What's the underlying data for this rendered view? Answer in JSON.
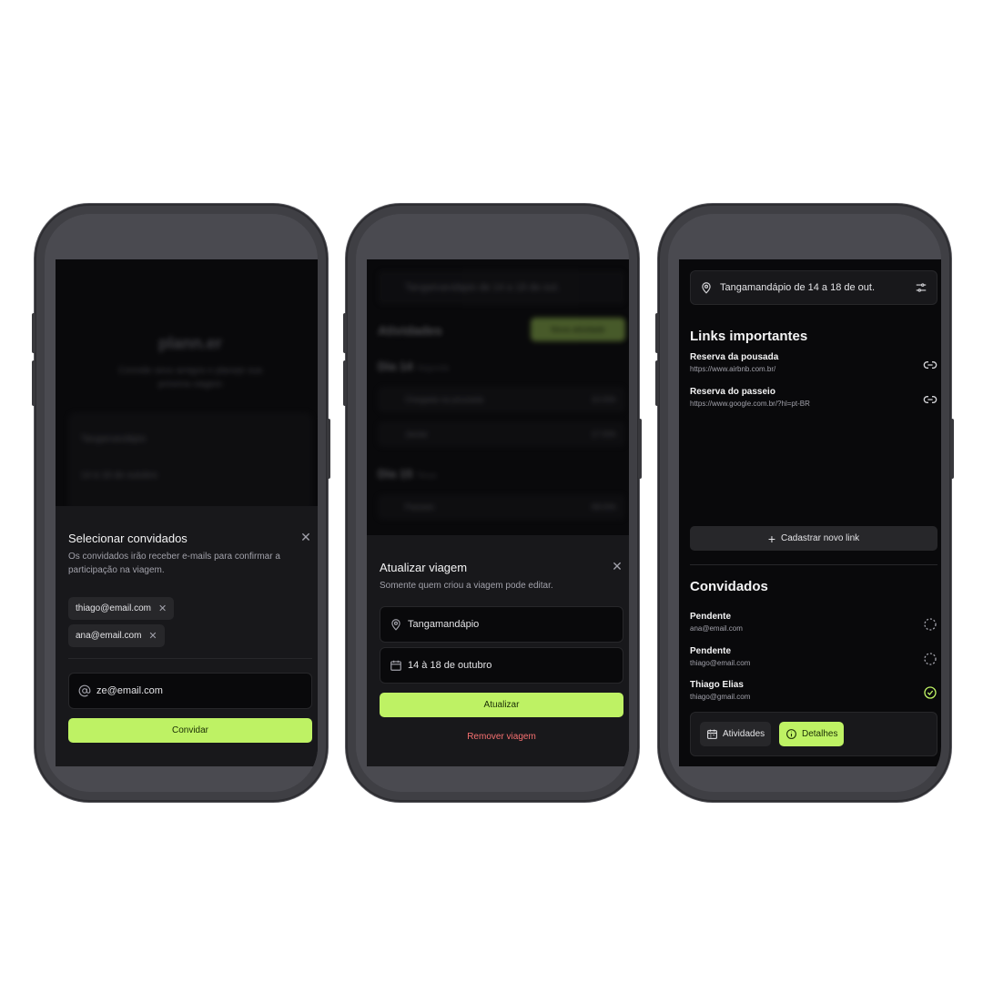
{
  "screen1": {
    "bg": {
      "logo": "plann.er",
      "subtitle": "Convide seus amigos e planeje sua próxima viagem",
      "destination": "Tangamandápio",
      "dates": "14 à 18 de outubro"
    },
    "sheet": {
      "title": "Selecionar convidados",
      "subtitle": "Os convidados irão receber e-mails para confirmar a participação na viagem.",
      "chips": [
        "thiago@email.com",
        "ana@email.com"
      ],
      "input_value": "ze@email.com",
      "button": "Convidar"
    }
  },
  "screen2": {
    "bg": {
      "bar": "Tangamandápio de 14 a 18 de out.",
      "heading": "Atividades",
      "new_button": "Nova atividade",
      "day1": "Dia 14",
      "day1_sub": "Segunda",
      "item1": "Chegada na pousada",
      "item1_time": "10:00h",
      "item2": "Jantar",
      "item2_time": "17:00h",
      "day2": "Dia 15",
      "day2_sub": "Terça",
      "item3": "Passeio",
      "item3_time": "08:00h"
    },
    "sheet": {
      "title": "Atualizar viagem",
      "subtitle": "Somente quem criou a viagem pode editar.",
      "destination": "Tangamandápio",
      "dates": "14 à 18 de outubro",
      "button": "Atualizar",
      "remove": "Remover viagem"
    }
  },
  "screen3": {
    "location": "Tangamandápio de 14 a 18 de out.",
    "links_title": "Links importantes",
    "links": [
      {
        "title": "Reserva da pousada",
        "url": "https://www.airbnb.com.br/"
      },
      {
        "title": "Reserva do passeio",
        "url": "https://www.google.com.br/?hl=pt-BR"
      }
    ],
    "new_link_button": "Cadastrar novo link",
    "guests_title": "Convidados",
    "guests": [
      {
        "name": "Pendente",
        "email": "ana@email.com",
        "confirmed": false
      },
      {
        "name": "Pendente",
        "email": "thiago@email.com",
        "confirmed": false
      },
      {
        "name": "Thiago Elias",
        "email": "thiago@gmail.com",
        "confirmed": true
      }
    ],
    "tabs": {
      "activities": "Atividades",
      "details": "Detalhes"
    }
  },
  "colors": {
    "accent": "#bef264",
    "danger": "#f87171",
    "background": "#09090b"
  }
}
